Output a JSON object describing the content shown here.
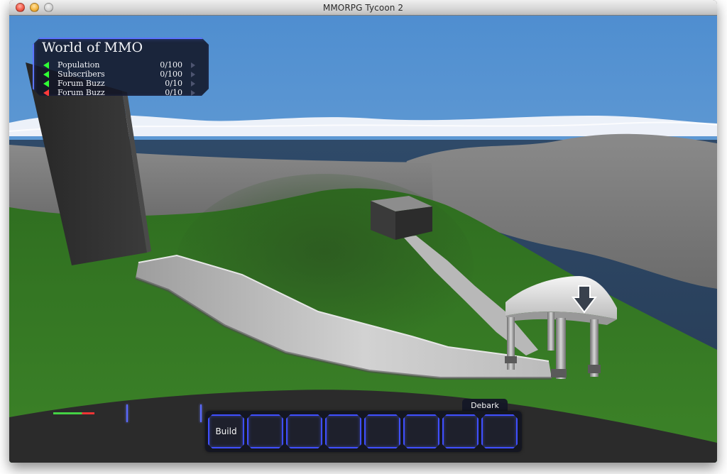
{
  "window": {
    "title": "MMORPG Tycoon 2"
  },
  "hud": {
    "stats_panel": {
      "title": "World of MMO",
      "rows": [
        {
          "label": "Population",
          "value": "0/100",
          "trend_icon": "green-left-arrow"
        },
        {
          "label": "Subscribers",
          "value": "0/100",
          "trend_icon": "green-left-arrow"
        },
        {
          "label": "Forum Buzz",
          "value": "0/10",
          "trend_icon": "green-left-arrow"
        },
        {
          "label": "Forum Buzz",
          "value": "0/10",
          "trend_icon": "red-left-arrow"
        }
      ]
    },
    "health_meter": {
      "green_fraction": 0.7,
      "red_fraction": 0.3
    },
    "bottom_bar": {
      "debark_label": "Debark",
      "slots": [
        {
          "label": "Build"
        },
        {
          "label": ""
        },
        {
          "label": ""
        },
        {
          "label": ""
        },
        {
          "label": ""
        },
        {
          "label": ""
        },
        {
          "label": ""
        },
        {
          "label": ""
        }
      ]
    }
  },
  "scene": {
    "objects": [
      "tall-dark-monolith",
      "small-dark-cube",
      "stone-walkway",
      "white-gazebo",
      "down-arrow-marker"
    ]
  },
  "colors": {
    "hud_accent": "#5b74ff",
    "positive": "#30ff35",
    "negative": "#ff3a3a",
    "sky": "#5f98d1",
    "grass": "#397825",
    "water": "#2d4462",
    "terrain": "#7f7f7f"
  }
}
